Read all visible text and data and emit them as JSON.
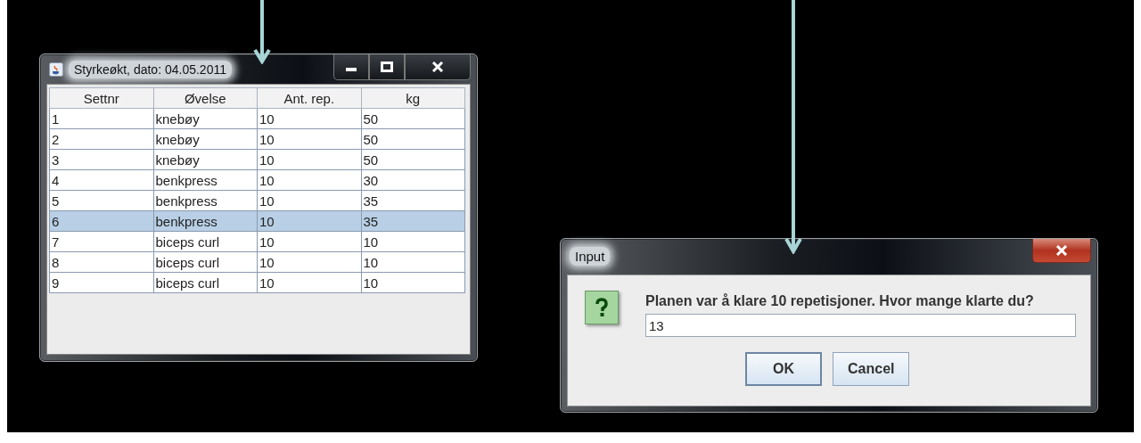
{
  "table_window": {
    "title": "Styrkeøkt, dato: 04.05.2011",
    "table": {
      "columns": [
        "Settnr",
        "Øvelse",
        "Ant. rep.",
        "kg"
      ],
      "rows": [
        {
          "cells": [
            "1",
            "knebøy",
            "10",
            "50"
          ],
          "selected": false
        },
        {
          "cells": [
            "2",
            "knebøy",
            "10",
            "50"
          ],
          "selected": false
        },
        {
          "cells": [
            "3",
            "knebøy",
            "10",
            "50"
          ],
          "selected": false
        },
        {
          "cells": [
            "4",
            "benkpress",
            "10",
            "30"
          ],
          "selected": false
        },
        {
          "cells": [
            "5",
            "benkpress",
            "10",
            "35"
          ],
          "selected": false
        },
        {
          "cells": [
            "6",
            "benkpress",
            "10",
            "35"
          ],
          "selected": true
        },
        {
          "cells": [
            "7",
            "biceps curl",
            "10",
            "10"
          ],
          "selected": false
        },
        {
          "cells": [
            "8",
            "biceps curl",
            "10",
            "10"
          ],
          "selected": false
        },
        {
          "cells": [
            "9",
            "biceps curl",
            "10",
            "10"
          ],
          "selected": false
        }
      ]
    }
  },
  "input_dialog": {
    "title": "Input",
    "message": "Planen var å klare 10 repetisjoner. Hvor mange klarte du?",
    "field": {
      "value": "13"
    },
    "buttons": [
      {
        "label": "OK",
        "selected": true
      },
      {
        "label": "Cancel",
        "selected": false
      }
    ]
  }
}
